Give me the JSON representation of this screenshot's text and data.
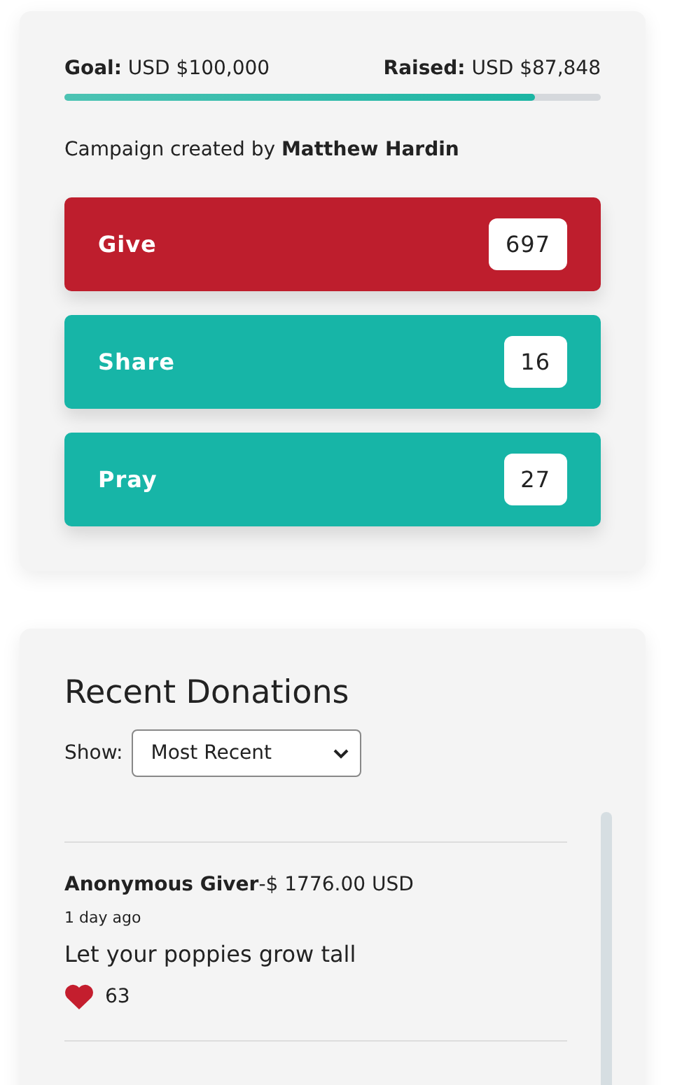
{
  "campaign": {
    "goal": "**Goal:** USD $100,000",
    "raised": "**Raised:** USD $87,848",
    "progress": {
      "level": 0.878
    },
    "creator": "Campaign created by **Matthew Hardin**",
    "actions": [
      {
        "kind": "give",
        "label": "Give",
        "count": "697"
      },
      {
        "kind": "share",
        "label": "Share",
        "count": "16"
      },
      {
        "kind": "pray",
        "label": "Pray",
        "count": "27"
      }
    ]
  },
  "donations": {
    "title": "Recent Donations",
    "show_label": "Show:",
    "sort": {
      "value": "Most Recent"
    },
    "items": [
      {
        "donor": "**Anonymous Giver**-$ 1776.00 USD",
        "time": "1 day ago",
        "message": "Let your poppies grow tall",
        "likes": "63"
      }
    ]
  }
}
